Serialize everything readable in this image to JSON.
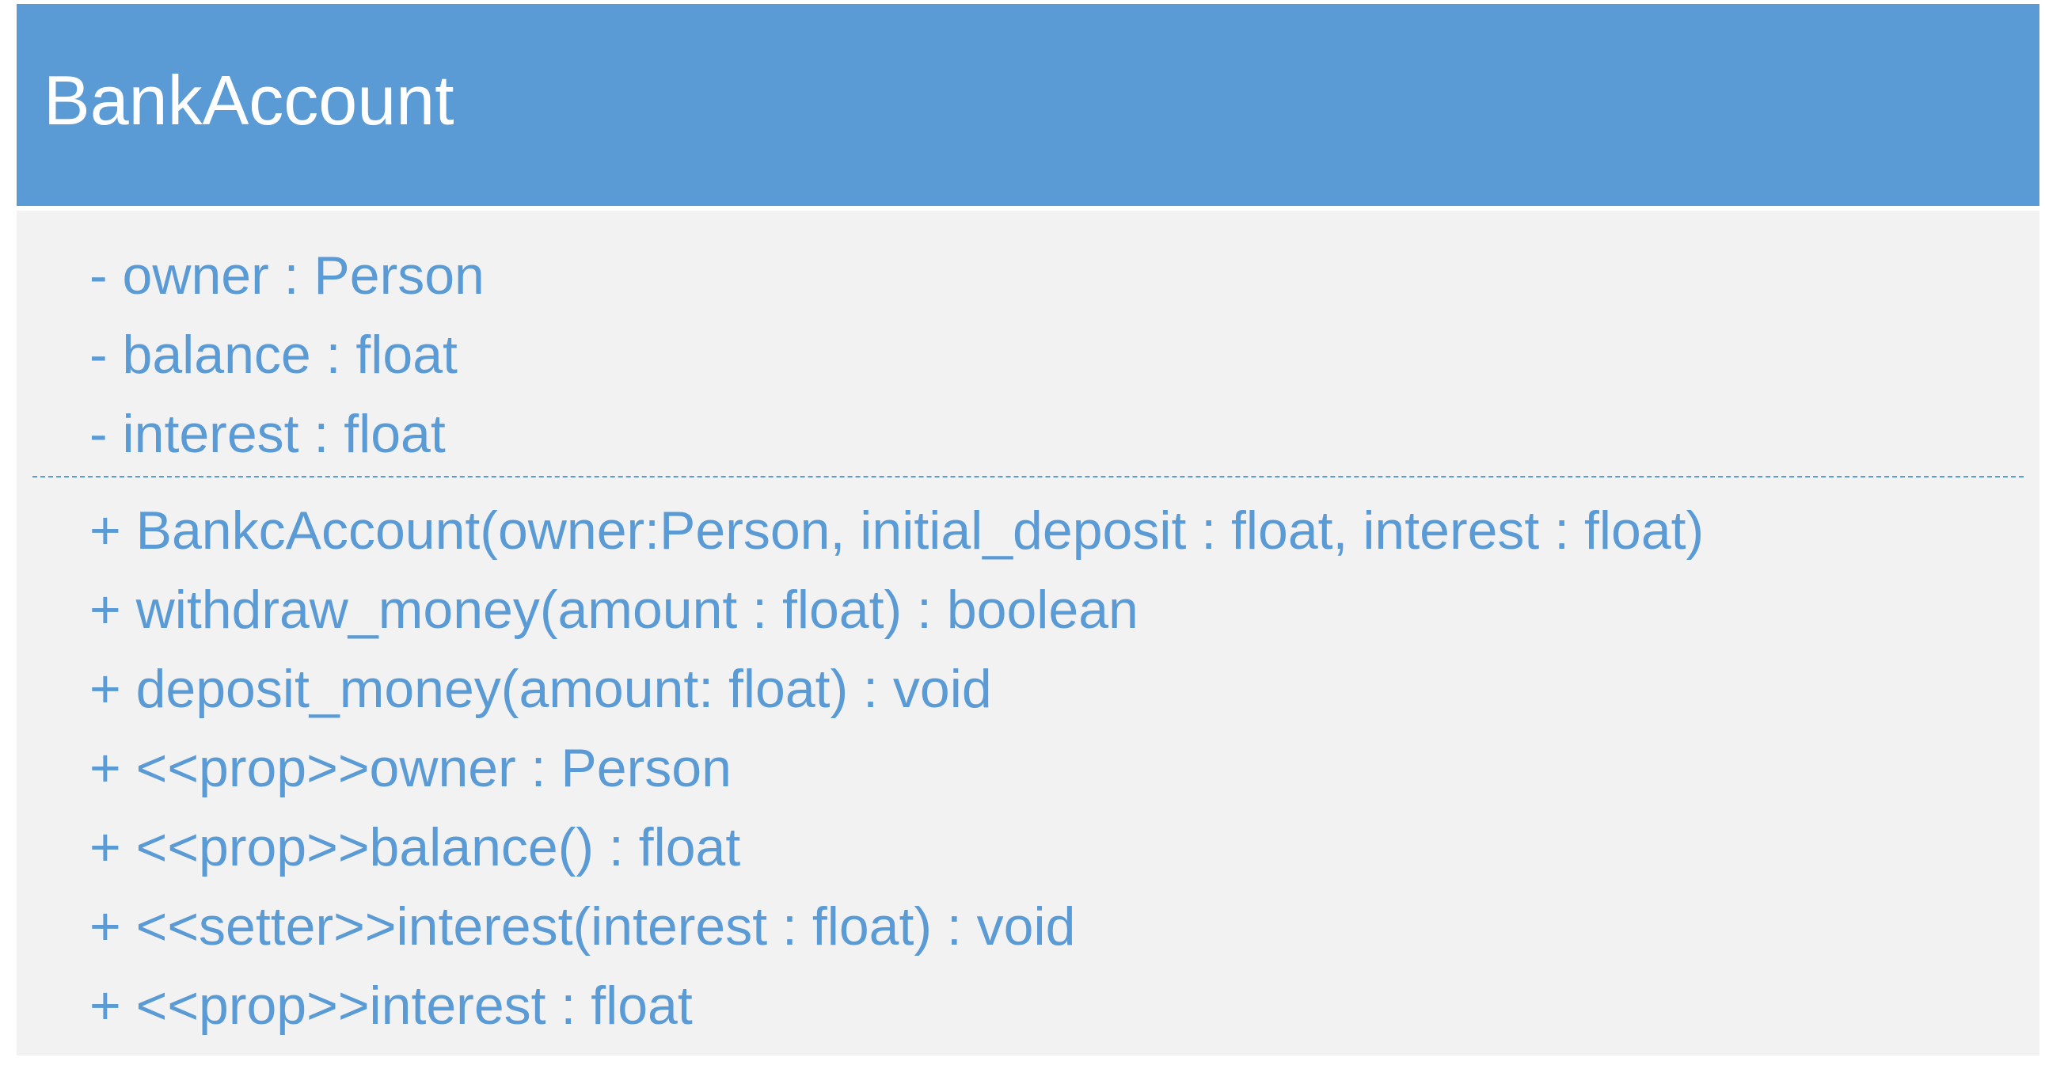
{
  "diagram": {
    "class_name": "BankAccount",
    "attributes": [
      "- owner : Person",
      "- balance : float",
      "- interest : float"
    ],
    "operations": [
      "+ BankcAccount(owner:Person, initial_deposit : float, interest : float)",
      "+ withdraw_money(amount : float) : boolean",
      "+ deposit_money(amount: float) : void",
      "+ <<prop>>owner : Person",
      "+ <<prop>>balance() : float",
      "+ <<setter>>interest(interest : float) : void",
      "+ <<prop>>interest : float"
    ]
  },
  "colors": {
    "header_background": "#5b9bd5",
    "body_background": "#f2f2f2",
    "header_text": "#ffffff",
    "member_text": "#5b9bd5",
    "divider": "#5b9bd5"
  }
}
